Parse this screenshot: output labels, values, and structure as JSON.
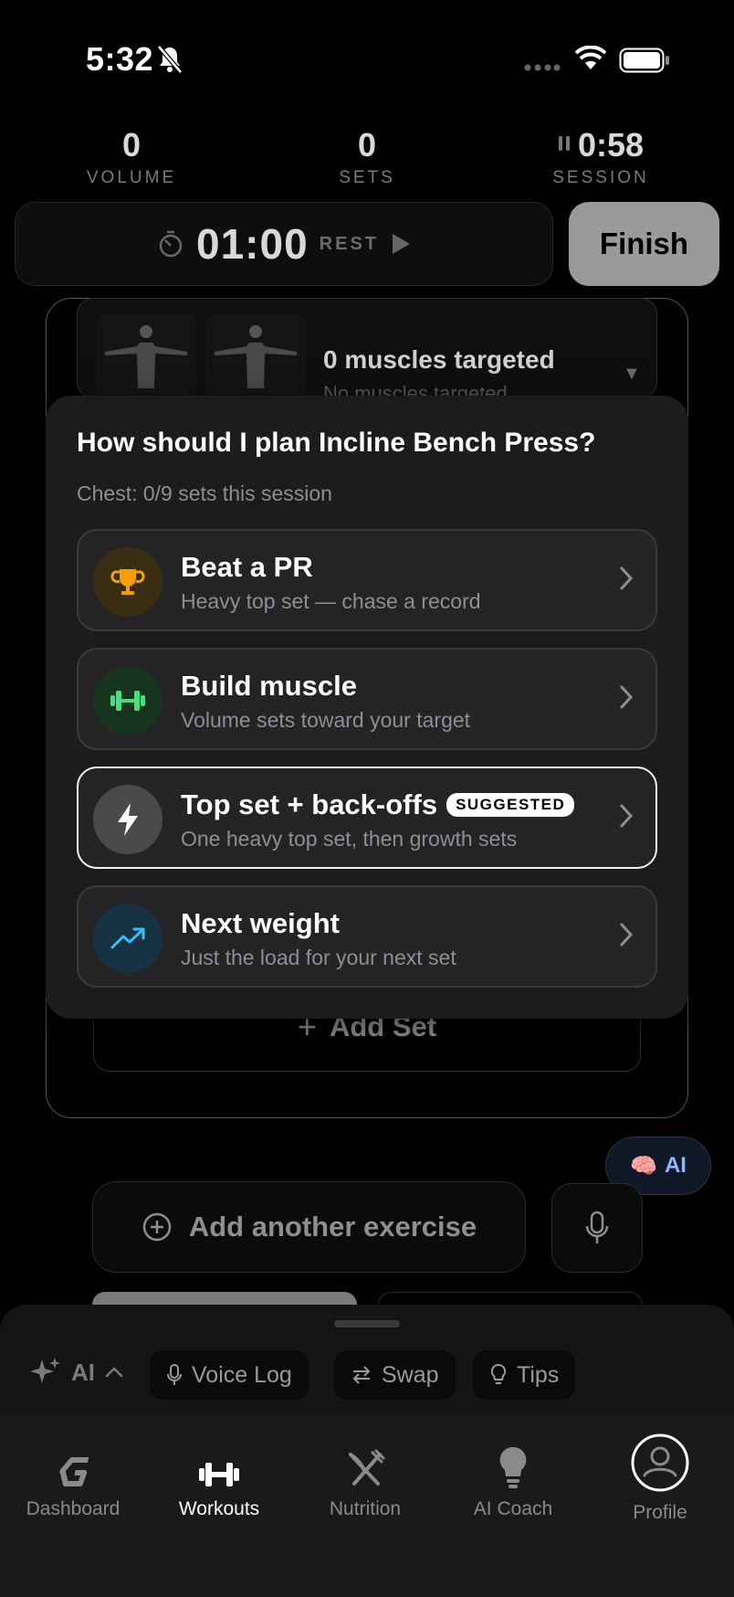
{
  "status_bar": {
    "time": "5:32"
  },
  "stats": [
    {
      "value": "0",
      "label": "VOLUME"
    },
    {
      "value": "0",
      "label": "SETS"
    },
    {
      "value": "0:58",
      "label": "SESSION"
    }
  ],
  "rest_timer": {
    "time": "01:00",
    "label": "REST"
  },
  "finish_label": "Finish",
  "muscles": {
    "title": "0 muscles targeted",
    "subtitle": "No muscles targeted"
  },
  "popup": {
    "title": "How should I plan Incline Bench Press?",
    "subtitle": "Chest: 0/9 sets this session",
    "options": [
      {
        "title": "Beat a PR",
        "desc": "Heavy top set — chase a record",
        "icon": "trophy-icon",
        "color": "#f59e0b"
      },
      {
        "title": "Build muscle",
        "desc": "Volume sets toward your target",
        "icon": "dumbbell-icon",
        "color": "#4ade80"
      },
      {
        "title": "Top set + back-offs",
        "desc": "One heavy top set, then growth sets",
        "icon": "bolt-icon",
        "badge": "SUGGESTED",
        "selected": true
      },
      {
        "title": "Next weight",
        "desc": "Just the load for your next set",
        "icon": "trend-up-icon",
        "color": "#38bdf8"
      }
    ]
  },
  "add_set_label": "Add Set",
  "ai_pill_label": "AI",
  "add_exercise_label": "Add another exercise",
  "sheet": {
    "ai_label": "AI",
    "chips": [
      "Voice Log",
      "Swap",
      "Tips"
    ]
  },
  "tabs": [
    {
      "label": "Dashboard",
      "icon": "logo-g-icon"
    },
    {
      "label": "Workouts",
      "icon": "dumbbell-icon",
      "active": true
    },
    {
      "label": "Nutrition",
      "icon": "fork-knife-icon"
    },
    {
      "label": "AI Coach",
      "icon": "lightbulb-icon"
    },
    {
      "label": "Profile",
      "icon": "profile-icon"
    }
  ]
}
